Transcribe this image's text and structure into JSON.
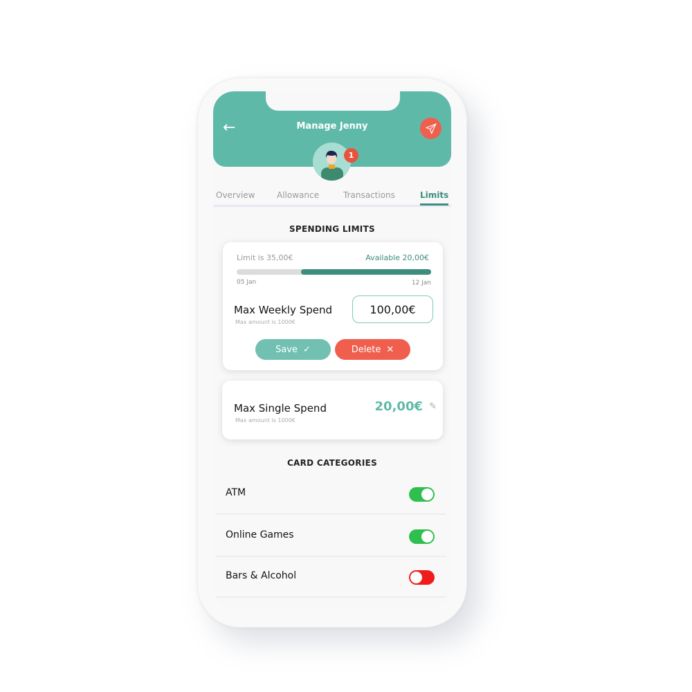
{
  "header": {
    "title": "Manage Jenny",
    "notification_count": "1"
  },
  "tabs": [
    {
      "label": "Overview"
    },
    {
      "label": "Allowance"
    },
    {
      "label": "Transactions"
    },
    {
      "label": "Limits",
      "active": true
    }
  ],
  "spending": {
    "heading": "SPENDING LIMITS",
    "limit_text": "Limit is 35,00€",
    "available_text": "Available 20,00€",
    "progress_fraction": 0.67,
    "start_date": "05 Jan",
    "end_date": "12 Jan",
    "weekly": {
      "label": "Max Weekly Spend",
      "hint": "Max amount is 1000€",
      "value": "100,00€"
    },
    "save_label": "Save",
    "delete_label": "Delete",
    "single": {
      "label": "Max Single Spend",
      "hint": "Max amount is 1000€",
      "value": "20,00€"
    }
  },
  "categories": {
    "heading": "CARD CATEGORIES",
    "items": [
      {
        "label": "ATM",
        "enabled": true
      },
      {
        "label": "Online Games",
        "enabled": true
      },
      {
        "label": "Bars & Alcohol",
        "enabled": false
      }
    ]
  },
  "colors": {
    "brand": "#5fb9a9",
    "accent_dark": "#3c8d7e",
    "danger": "#ef5f4e",
    "toggle_on": "#2fbf4f",
    "toggle_off": "#f01c1c"
  }
}
